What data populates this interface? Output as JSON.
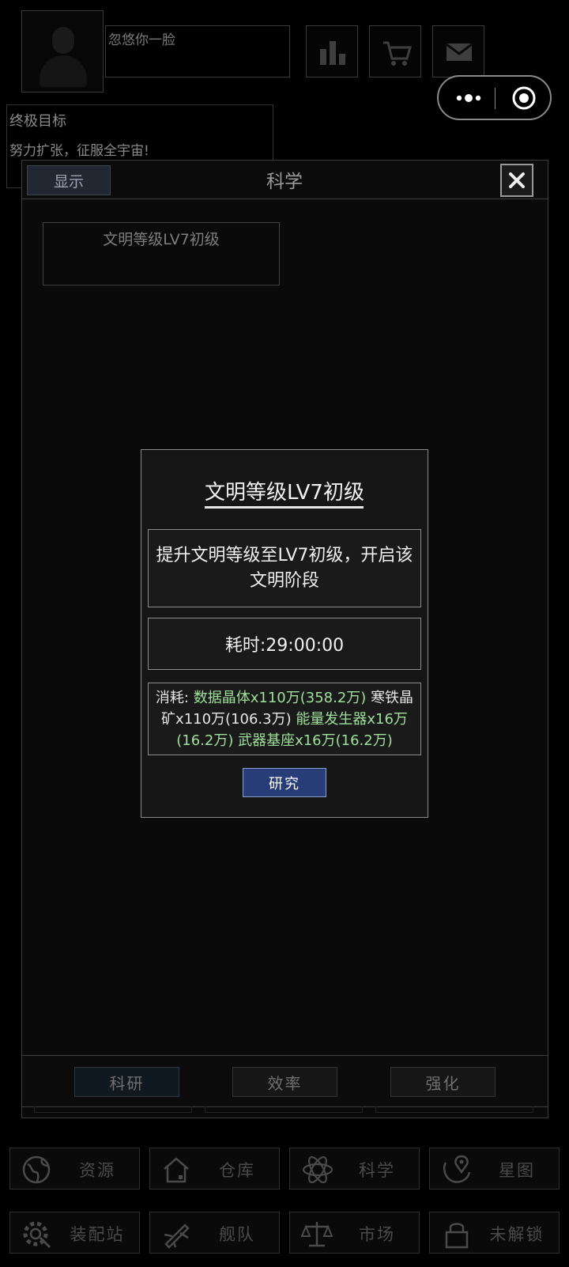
{
  "profile": {
    "nickname": "忽悠你一脸"
  },
  "top_buttons": {
    "stats_icon": "bar-chart-icon",
    "shop_icon": "cart-icon",
    "mail_icon": "mail-icon"
  },
  "capsule": {
    "more_icon": "more-dots-icon",
    "close_icon": "target-close-icon"
  },
  "goal": {
    "title": "终极目标",
    "description": "努力扩张，征服全宇宙!"
  },
  "science_panel": {
    "show_button": "显示",
    "title": "科学",
    "tech_card": "文明等级LV7初级",
    "tabs": [
      "科研",
      "效率",
      "强化"
    ]
  },
  "nav": [
    {
      "label": "资源",
      "icon": "globe-icon"
    },
    {
      "label": "仓库",
      "icon": "house-icon"
    },
    {
      "label": "科学",
      "icon": "atom-icon"
    },
    {
      "label": "星图",
      "icon": "map-pin-icon"
    },
    {
      "label": "装配站",
      "icon": "gear-icon"
    },
    {
      "label": "舰队",
      "icon": "ship-icon"
    },
    {
      "label": "市场",
      "icon": "scale-icon"
    },
    {
      "label": "未解锁",
      "icon": "lock-icon"
    }
  ],
  "modal": {
    "title": "文明等级LV7初级",
    "description": "提升文明等级至LV7初级，开启该文明阶段",
    "time": "耗时:29:00:00",
    "cost_label": "消耗:",
    "costs": [
      "数据晶体x110万(358.2万)",
      "寒铁晶矿x110万(106.3万)",
      "能量发生器x16万(16.2万)",
      "武器基座x16万(16.2万)"
    ],
    "research_button": "研究",
    "colors": {
      "sufficient": "#9ee09a",
      "insufficient": "#e6e6e6",
      "button": "#283c78"
    }
  }
}
